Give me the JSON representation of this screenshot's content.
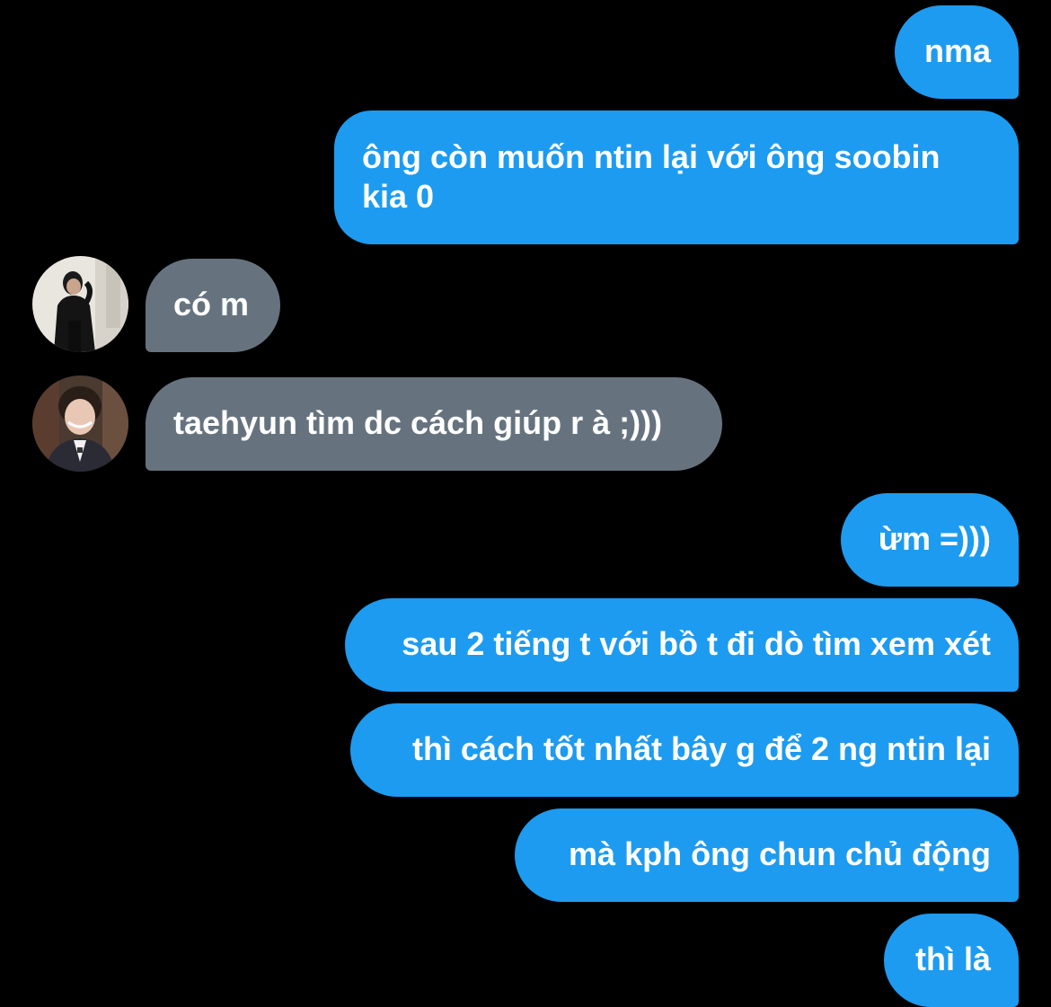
{
  "messages": [
    {
      "from": "me",
      "text": "nma"
    },
    {
      "from": "me",
      "text": "ông còn muốn ntin lại với ông soobin kia 0"
    },
    {
      "from": "them",
      "text": "có m"
    },
    {
      "from": "them",
      "text": "taehyun tìm dc cách giúp r à ;)))"
    },
    {
      "from": "me",
      "text": "ừm =)))"
    },
    {
      "from": "me",
      "text": "sau 2 tiếng t với bồ t đi dò tìm xem xét"
    },
    {
      "from": "me",
      "text": "thì cách tốt nhất bây g để 2 ng ntin lại"
    },
    {
      "from": "me",
      "text": "mà kph ông chun chủ động"
    },
    {
      "from": "me",
      "text": "thì là"
    }
  ],
  "colors": {
    "background": "#000000",
    "outgoing_bubble": "#1d9bf0",
    "incoming_bubble": "#66737f",
    "text": "#ffffff"
  }
}
